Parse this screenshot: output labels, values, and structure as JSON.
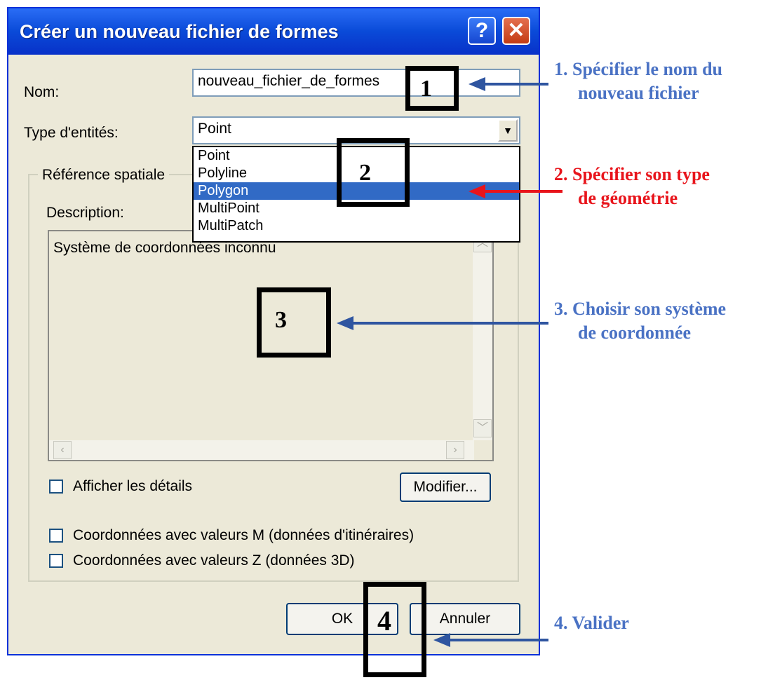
{
  "dialog": {
    "title": "Créer un nouveau fichier de formes",
    "help_label": "?",
    "close_label": "✕",
    "name_label": "Nom:",
    "name_value": "nouveau_fichier_de_formes",
    "type_label": "Type d'entités:",
    "type_value": "Point",
    "dropdown_options": [
      "Point",
      "Polyline",
      "Polygon",
      "MultiPoint",
      "MultiPatch"
    ],
    "dropdown_selected": "Polygon",
    "group_label": "Référence spatiale",
    "description_label": "Description:",
    "description_text": "Système de coordonnées inconnu",
    "show_details_label": "Afficher les détails",
    "modify_label": "Modifier...",
    "m_values_label": "Coordonnées avec valeurs M (données d'itinéraires)",
    "z_values_label": "Coordonnées avec valeurs Z (données 3D)",
    "ok_label": "OK",
    "cancel_label": "Annuler"
  },
  "callouts": [
    "1",
    "2",
    "3",
    "4"
  ],
  "annotations": {
    "a1_line1": "1.  Spécifier le nom du",
    "a1_line2": "nouveau fichier",
    "a2_line1": "2.  Spécifier   son   type",
    "a2_line2": "de géométrie",
    "a3_line1": "3.  Choisir son système",
    "a3_line2": "de coordonnée",
    "a4": "4.  Valider"
  },
  "colors": {
    "annotation_blue": "#4a72c4",
    "annotation_red": "#e8141b",
    "arrow_blue": "#2f55a0",
    "arrow_red": "#e8141b",
    "selection": "#316ac5"
  }
}
